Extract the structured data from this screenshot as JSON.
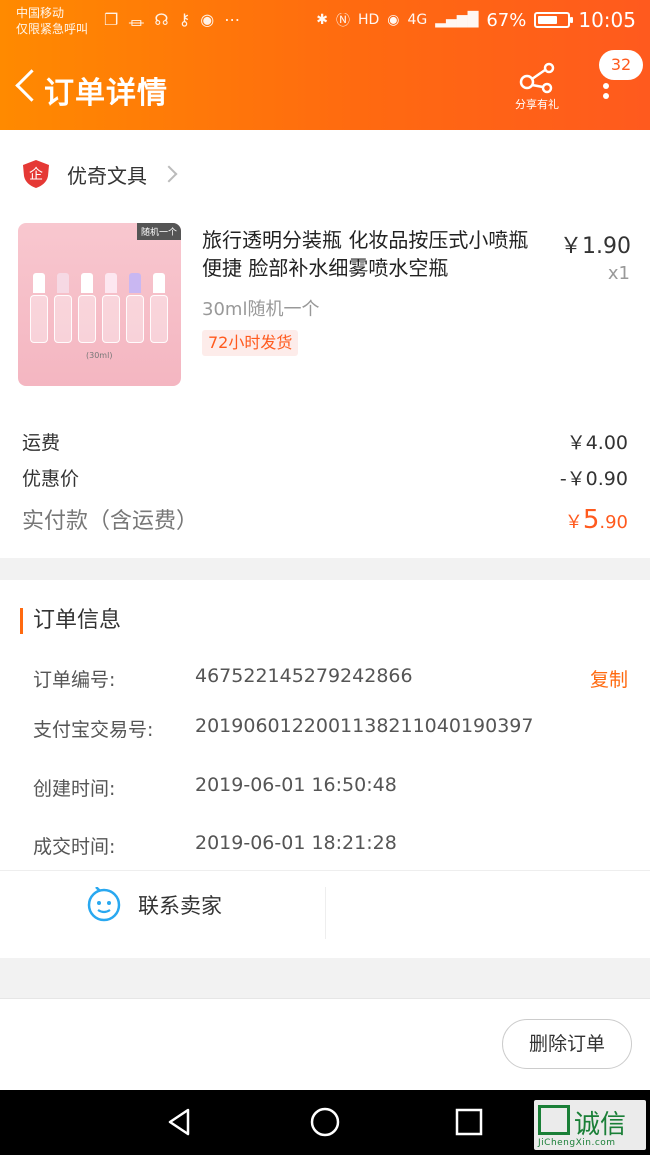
{
  "status_bar": {
    "carrier_line1": "中国移动",
    "carrier_line2": "仅限紧急呼叫",
    "extra_icons": "⋯",
    "network": "4G",
    "battery_percent": "67%",
    "battery_level": 0.67,
    "time": "10:05"
  },
  "header": {
    "title": "订单详情",
    "share_label": "分享有礼",
    "message_count": "32",
    "background_colors": [
      "#ff8a00",
      "#ff5a1e"
    ]
  },
  "shop": {
    "name": "优奇文具",
    "badge_char": "企",
    "badge_color": "#e53935"
  },
  "product": {
    "title": "旅行透明分装瓶 化妆品按压式小喷瓶便捷 脸部补水细雾喷水空瓶",
    "price": "￥1.90",
    "quantity": "x1",
    "sku": "30ml随机一个",
    "shipping_tag": "72小时发货",
    "image_tag": "随机一个",
    "image_caption": "(30ml)"
  },
  "fees": {
    "shipping_label": "运费",
    "shipping_value": "￥4.00",
    "discount_label": "优惠价",
    "discount_value": "-￥0.90",
    "paid_label": "实付款（含运费）",
    "paid_currency": "￥",
    "paid_integer": "5",
    "paid_decimal": ".90"
  },
  "order_info": {
    "section_title": "订单信息",
    "rows": [
      {
        "label": "订单编号:",
        "value": "467522145279242866"
      },
      {
        "label": "支付宝交易号:",
        "value": "2019060122001138211040190397"
      },
      {
        "label": "创建时间:",
        "value": "2019-06-01 16:50:48"
      },
      {
        "label": "成交时间:",
        "value": "2019-06-01 18:21:28"
      }
    ],
    "copy_label": "复制",
    "contact_label": "联系卖家"
  },
  "actions": {
    "delete_label": "删除订单"
  },
  "watermark": {
    "text": "诚信",
    "sub": "JiChengXin.com"
  },
  "accent_color": "#ff6a10"
}
